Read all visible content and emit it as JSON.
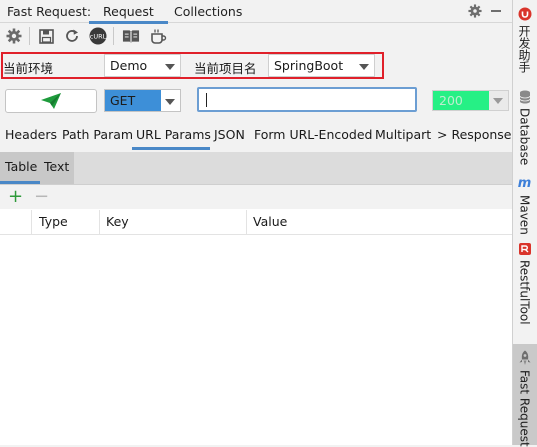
{
  "titlebar": {
    "title": "Fast Request:",
    "tabs": [
      {
        "label": "Request",
        "active": true
      },
      {
        "label": "Collections",
        "active": false
      }
    ]
  },
  "toolbar": {
    "icons": [
      "settings-icon",
      "save-icon",
      "refresh-icon",
      "curl-icon",
      "book-icon",
      "coffee-icon"
    ],
    "curl_label": "cURL"
  },
  "env": {
    "env_label": "当前环境",
    "env_value": "Demo",
    "project_label": "当前项目名",
    "project_value": "SpringBoot"
  },
  "request": {
    "method": "GET",
    "url": "",
    "status": "200"
  },
  "param_tabs": [
    "Headers",
    "Path Param",
    "URL Params",
    "JSON",
    "Form URL-Encoded",
    "Multipart",
    "> Response"
  ],
  "active_param_tab": "URL Params",
  "sub_tabs": [
    "Table",
    "Text"
  ],
  "table": {
    "columns": [
      "Type",
      "Key",
      "Value"
    ],
    "rows": []
  },
  "sidebar": {
    "items": [
      {
        "label": "开发助手",
        "icon": "kaifa-icon"
      },
      {
        "label": "Database",
        "icon": "database-icon"
      },
      {
        "label": "Maven",
        "icon": "maven-icon"
      },
      {
        "label": "RestfulTool",
        "icon": "restfultool-icon"
      },
      {
        "label": "Fast Request",
        "icon": "rocket-icon"
      }
    ]
  },
  "colors": {
    "accent": "#4a88c7",
    "highlight_border": "#e0202a",
    "method_bg": "#3d8fd8",
    "status_bg": "#26f085",
    "send_icon": "#1e9b3c"
  }
}
